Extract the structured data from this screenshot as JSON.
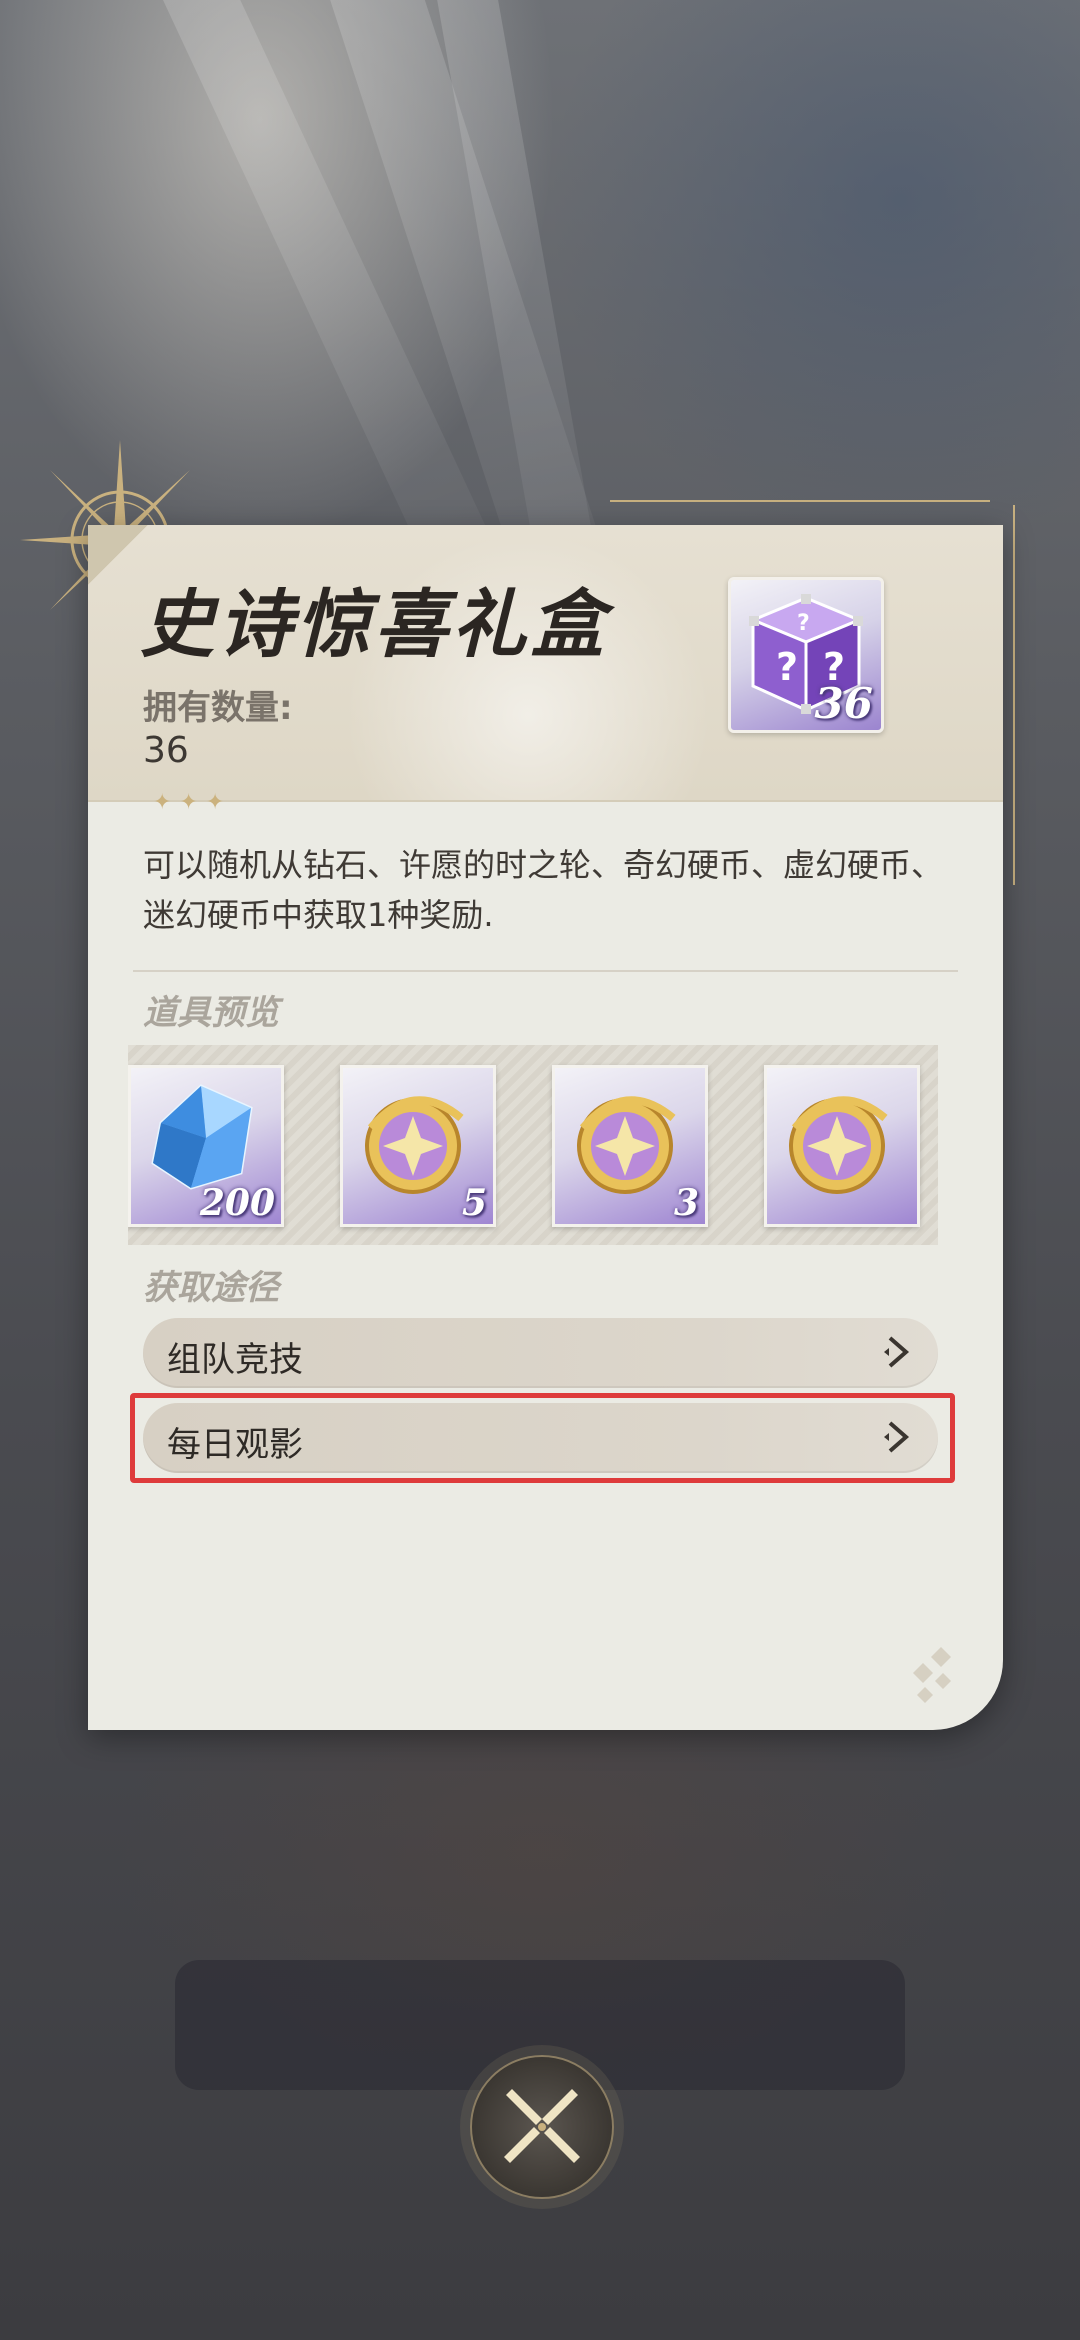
{
  "dialog": {
    "title": "史诗惊喜礼盒",
    "owned_label": "拥有数量:",
    "owned_value": "36",
    "icon_count": "36",
    "stars": "✦✦✦",
    "description": "可以随机从钻石、许愿的时之轮、奇幻硬币、虚幻硬币、迷幻硬币中获取1种奖励."
  },
  "preview": {
    "section_title": "道具预览",
    "items": [
      {
        "icon": "diamond-icon",
        "qty": "200"
      },
      {
        "icon": "fantasy-coin-icon",
        "qty": "5"
      },
      {
        "icon": "fantasy-coin-icon",
        "qty": "3"
      },
      {
        "icon": "fantasy-coin-icon",
        "qty": ""
      }
    ]
  },
  "sources": {
    "section_title": "获取途径",
    "items": [
      {
        "label": "组队竞技"
      },
      {
        "label": "每日观影"
      }
    ]
  },
  "colors": {
    "panel_bg": "#ebebe4",
    "accent_gold": "#c7b080",
    "highlight_red": "#de3b3b",
    "item_purple": "#9f86d2"
  }
}
